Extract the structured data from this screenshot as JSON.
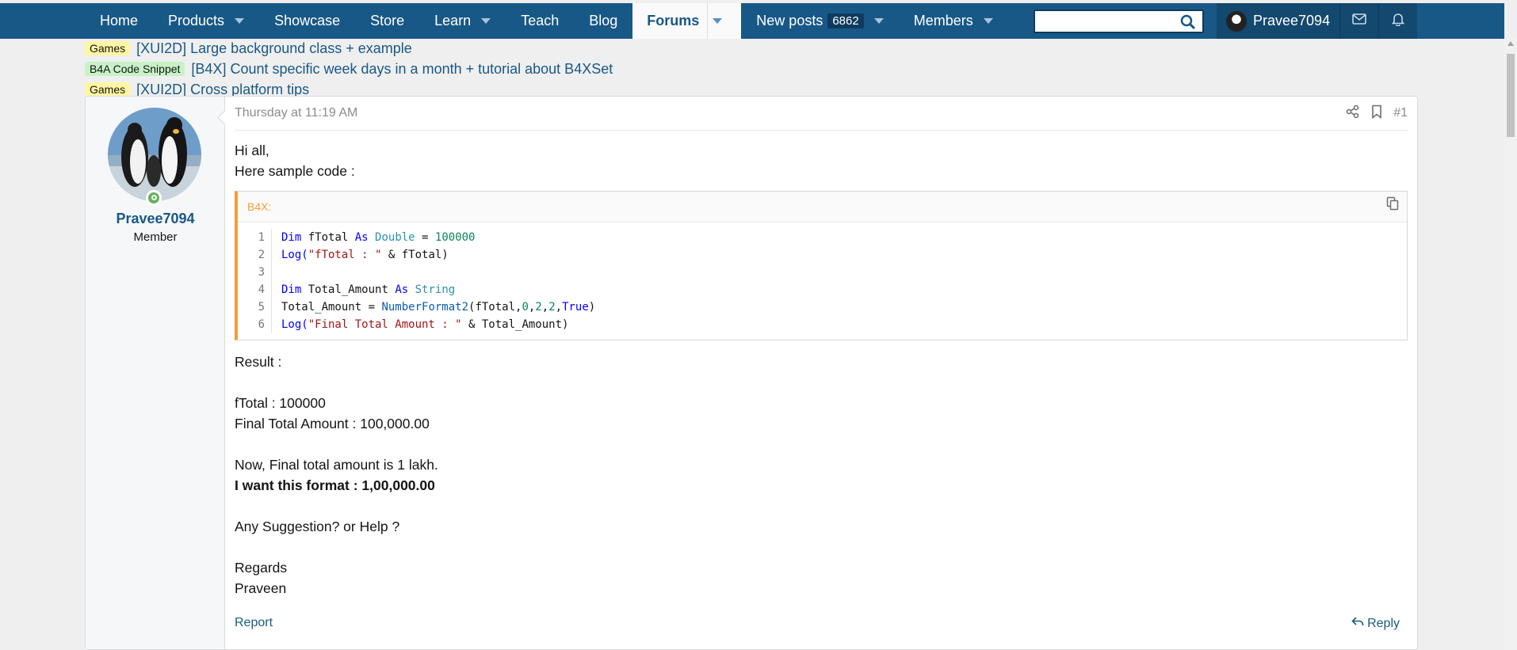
{
  "nav": {
    "tabs": [
      {
        "label": "Home"
      },
      {
        "label": "Products"
      },
      {
        "label": "Showcase"
      },
      {
        "label": "Store"
      },
      {
        "label": "Learn"
      },
      {
        "label": "Teach"
      },
      {
        "label": "Blog"
      },
      {
        "label": "Forums"
      },
      {
        "label": "New posts",
        "badge": "6862"
      },
      {
        "label": "Members"
      }
    ],
    "search_value": "",
    "username": "Pravee7094"
  },
  "related": [
    {
      "prefix": "Games",
      "title": "[XUI2D] Large background class + example"
    },
    {
      "prefix": "B4A Code Snippet",
      "title": "[B4X] Count specific week days in a month + tutorial about B4XSet"
    },
    {
      "prefix": "Games",
      "title": "[XUI2D] Cross platform tips"
    }
  ],
  "post": {
    "author": "Pravee7094",
    "author_title": "Member",
    "timestamp": "Thursday at 11:19 AM",
    "number": "#1",
    "intro": [
      "Hi all,",
      "Here sample code :"
    ],
    "code_lang": "B4X:",
    "code_lines": [
      "1",
      "2",
      "3",
      "4",
      "5",
      "6"
    ],
    "result_label": "Result :",
    "result_lines": [
      "fTotal : 100000",
      "Final Total Amount : 100,000.00"
    ],
    "note": "Now, Final total amount is 1 lakh.",
    "wanted": "I want this format : 1,00,000.00",
    "question": "Any Suggestion? or Help ?",
    "signoff": [
      "Regards",
      "Praveen"
    ],
    "report_label": "Report",
    "reply_label": "Reply"
  },
  "code": {
    "l1": [
      "Dim",
      " fTotal ",
      "As",
      " ",
      "Double",
      " = ",
      "100000"
    ],
    "l2": [
      "Log(",
      "\"fTotal : \"",
      " & fTotal)"
    ],
    "l4": [
      "Dim",
      " Total_Amount ",
      "As",
      " ",
      "String"
    ],
    "l5": [
      "Total_Amount = ",
      "NumberFormat2",
      "(fTotal,",
      "0",
      ",",
      "2",
      ",",
      "2",
      ",",
      "True",
      ")"
    ],
    "l6": [
      "Log(",
      "\"Final Total Amount : \"",
      " & Total_Amount)"
    ]
  },
  "colors": {
    "nav_bg": "#185886",
    "link": "#185886",
    "code_accent": "#f49d37",
    "online": "#63b359"
  }
}
